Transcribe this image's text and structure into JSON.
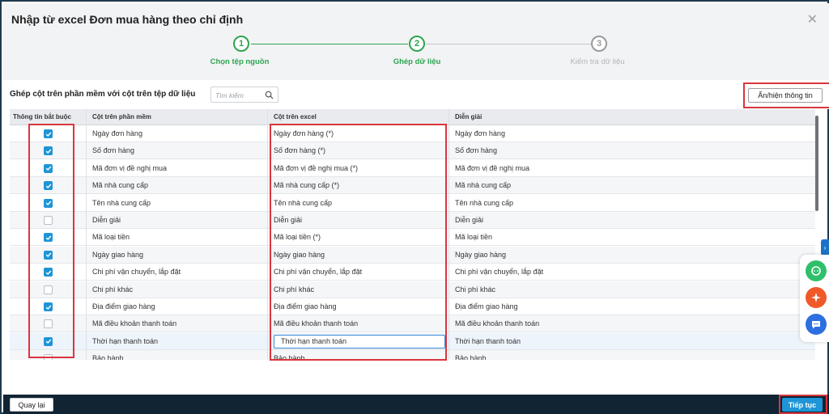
{
  "dialog": {
    "title": "Nhập từ excel Đơn mua hàng theo chỉ định",
    "close_glyph": "✕"
  },
  "steps": [
    {
      "number": "1",
      "label": "Chọn tệp nguồn",
      "state": "done"
    },
    {
      "number": "2",
      "label": "Ghép dữ liệu",
      "state": "active"
    },
    {
      "number": "3",
      "label": "Kiểm tra dữ liệu",
      "state": "pending"
    }
  ],
  "toolbar": {
    "title": "Ghép cột trên phần mềm với cột trên tệp dữ liệu",
    "search_placeholder": "Tìm kiếm",
    "toggle_label": "Ẩn/hiện thông tin"
  },
  "table": {
    "headers": [
      "Thông tin bắt buộc",
      "Cột trên phần mềm",
      "Cột trên excel",
      "Diễn giải"
    ],
    "rows": [
      {
        "required": true,
        "software": "Ngày đơn hàng",
        "excel": "Ngày đơn hàng (*)",
        "desc": "Ngày đơn hàng"
      },
      {
        "required": true,
        "software": "Số đơn hàng",
        "excel": "Số đơn hàng (*)",
        "desc": "Số đơn hàng"
      },
      {
        "required": true,
        "software": "Mã đơn vị đề nghị mua",
        "excel": "Mã đơn vị đề nghị mua (*)",
        "desc": "Mã đơn vị đề nghị mua"
      },
      {
        "required": true,
        "software": "Mã nhà cung cấp",
        "excel": "Mã nhà cung cấp (*)",
        "desc": "Mã nhà cung cấp"
      },
      {
        "required": true,
        "software": "Tên nhà cung cấp",
        "excel": "Tên nhà cung cấp",
        "desc": "Tên nhà cung cấp"
      },
      {
        "required": false,
        "software": "Diễn giải",
        "excel": "Diễn giải",
        "desc": "Diễn giải"
      },
      {
        "required": true,
        "software": "Mã loại tiền",
        "excel": "Mã loại tiền (*)",
        "desc": "Mã loại tiền"
      },
      {
        "required": true,
        "software": "Ngày giao hàng",
        "excel": "Ngày giao hàng",
        "desc": "Ngày giao hàng"
      },
      {
        "required": true,
        "software": "Chi phí vận chuyển, lắp đặt",
        "excel": "Chi phí vận chuyển, lắp đặt",
        "desc": "Chi phí vận chuyển, lắp đặt"
      },
      {
        "required": false,
        "software": "Chi phí khác",
        "excel": "Chi phí khác",
        "desc": "Chi phí khác"
      },
      {
        "required": true,
        "software": "Địa điểm giao hàng",
        "excel": "Địa điểm giao hàng",
        "desc": "Địa điểm giao hàng"
      },
      {
        "required": false,
        "software": "Mã điều khoản thanh toán",
        "excel": "Mã điều khoản thanh toán",
        "desc": "Mã điều khoản thanh toán"
      },
      {
        "required": true,
        "software": "Thời hạn thanh toán",
        "excel": "Thời hạn thanh toán",
        "desc": "Thời hạn thanh toán",
        "editing": true
      },
      {
        "required": false,
        "software": "Bảo hành",
        "excel": "Bảo hành",
        "desc": "Bảo hành"
      }
    ]
  },
  "footer": {
    "back_label": "Quay lại",
    "next_label": "Tiếp tục"
  },
  "colors": {
    "accent_green": "#2ea44f",
    "accent_blue": "#1e95d6",
    "highlight_red": "#d9363e",
    "footer_bg": "#102433"
  },
  "widgets": [
    "chat-bubble-icon",
    "sparkle-icon",
    "message-icon"
  ]
}
